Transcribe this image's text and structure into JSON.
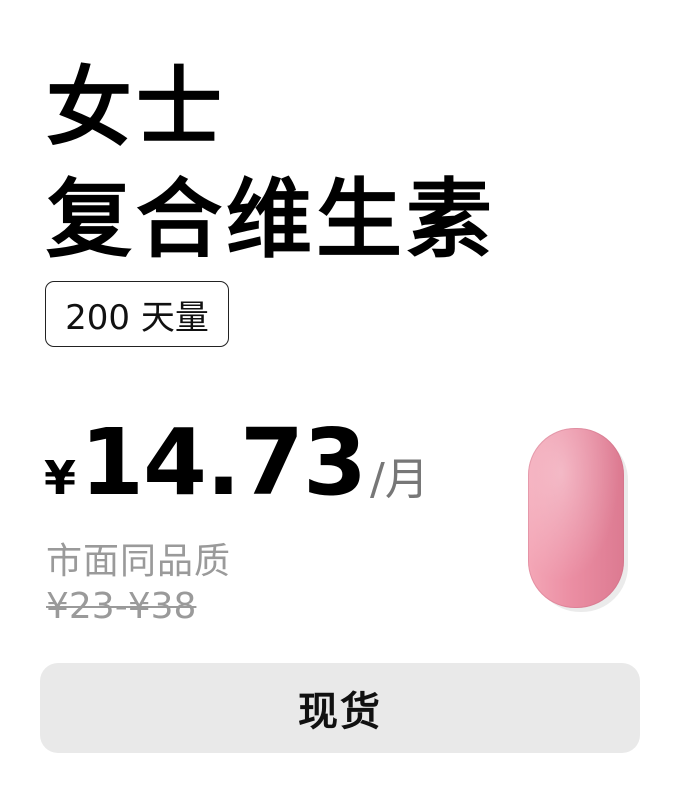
{
  "product": {
    "title_line1": "女士",
    "title_line2": "复合维生素",
    "badge": "200 天量"
  },
  "pricing": {
    "currency": "¥",
    "amount": "14.73",
    "unit": "/月",
    "compare_label": "市面同品质",
    "compare_range": "¥23-¥38"
  },
  "actions": {
    "stock_label": "现货"
  },
  "image": {
    "icon": "pink-oval-tablet-icon",
    "color": "#e88aa0"
  },
  "colors": {
    "button_bg": "#e9e9e9",
    "muted_text": "#9a9a9a"
  }
}
